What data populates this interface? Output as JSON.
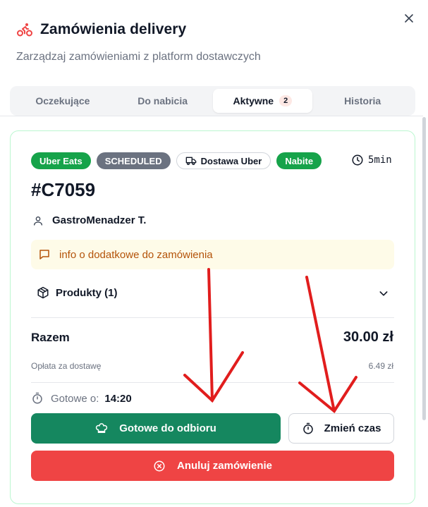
{
  "header": {
    "title": "Zamówienia delivery",
    "subtitle": "Zarządzaj zamówieniami z platform dostawczych",
    "icon": "bicycle-icon",
    "accent_color": "#ef4444"
  },
  "tabs": [
    {
      "label": "Oczekujące",
      "active": false
    },
    {
      "label": "Do nabicia",
      "active": false
    },
    {
      "label": "Aktywne",
      "active": true,
      "count": "2"
    },
    {
      "label": "Historia",
      "active": false
    }
  ],
  "order": {
    "badges": {
      "platform": "Uber Eats",
      "schedule": "SCHEDULED",
      "delivery": "Dostawa Uber",
      "status": "Nabite"
    },
    "elapsed": "5min",
    "id": "#C7059",
    "customer": "GastroMenadzer T.",
    "note": "info o dodatkowe do zamówienia",
    "products_label": "Produkty (1)",
    "total_label": "Razem",
    "total_value": "30.00 zł",
    "fee_label": "Opłata za dostawę",
    "fee_value": "6.49 zł",
    "ready_label": "Gotowe o:",
    "ready_time": "14:20",
    "buttons": {
      "ready": "Gotowe do odbioru",
      "change_time": "Zmień czas",
      "cancel": "Anuluj zamówienie"
    }
  },
  "colors": {
    "green_badge": "#16a34a",
    "gray_badge": "#6b7280",
    "ready_button": "#15875f",
    "cancel_button": "#ef4444",
    "annotation_arrow": "#e11d1d"
  }
}
